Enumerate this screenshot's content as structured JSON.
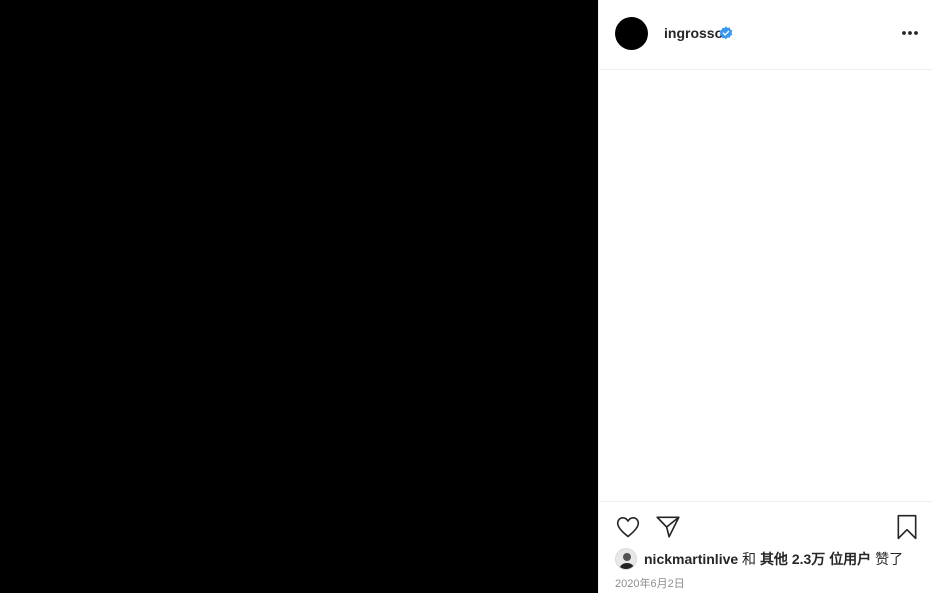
{
  "post": {
    "author": {
      "username": "ingrosso",
      "verified": true,
      "avatar_color": "#000000"
    },
    "menu_icon": "more-horizontal-icon",
    "likes": {
      "liker_username": "nickmartinlive",
      "connector": "和",
      "others_label": "其他",
      "count": "2.3万",
      "users_label": "位用户",
      "suffix": "赞了"
    },
    "date": "2020年6月2日",
    "actions": {
      "like_icon": "heart-icon",
      "share_icon": "paper-plane-icon",
      "save_icon": "bookmark-icon"
    }
  },
  "colors": {
    "media_background": "#000000",
    "verified_badge": "#3897f0",
    "divider": "#efefef",
    "muted_text": "#8e8e8e"
  }
}
